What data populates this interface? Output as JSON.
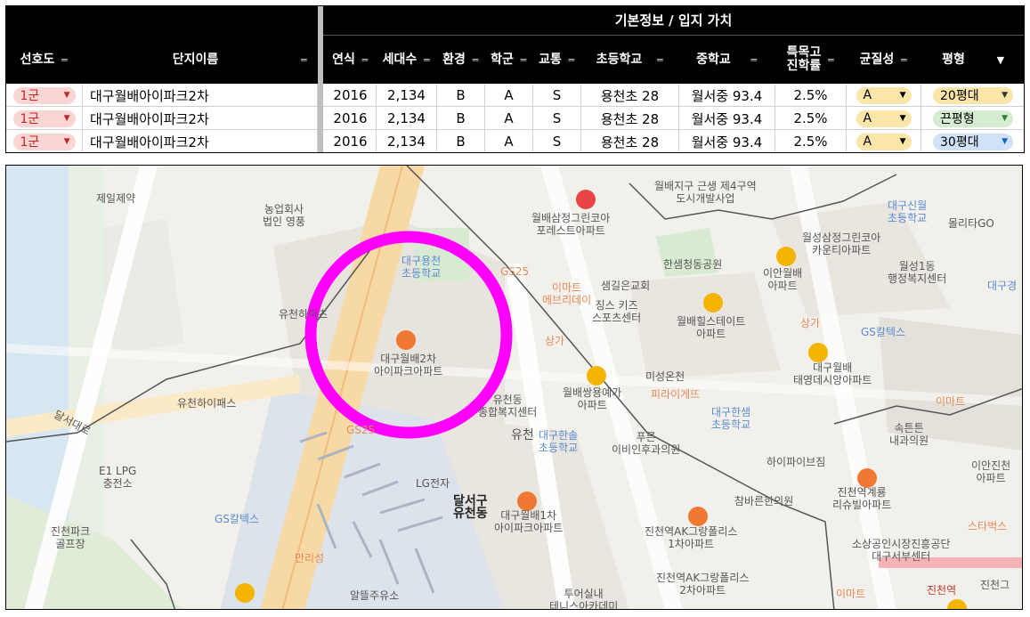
{
  "sheet": {
    "group_title": "기본정보 / 입지 가치",
    "headers": {
      "pref": "선호도",
      "name": "단지이름",
      "year": "연식",
      "households": "세대수",
      "env": "환경",
      "school_district": "학군",
      "transit": "교통",
      "elementary": "초등학교",
      "middle": "중학교",
      "special_hs": "특목고\n진학률",
      "uniformity": "균질성",
      "size": "평형"
    },
    "rows": [
      {
        "pref": "1군",
        "name": "대구월배아이파크2차",
        "year": "2016",
        "households": "2,134",
        "env": "B",
        "school_district": "A",
        "transit": "S",
        "elementary": "용천초 28",
        "middle": "월서중 93.4",
        "special_hs": "2.5%",
        "uniformity": "A",
        "size": "20평대",
        "size_color": "#fbe5a8"
      },
      {
        "pref": "1군",
        "name": "대구월배아이파크2차",
        "year": "2016",
        "households": "2,134",
        "env": "B",
        "school_district": "A",
        "transit": "S",
        "elementary": "용천초 28",
        "middle": "월서중 93.4",
        "special_hs": "2.5%",
        "uniformity": "A",
        "size": "끈평형",
        "size_color": "#d5ecd2"
      },
      {
        "pref": "1군",
        "name": "대구월배아이파크2차",
        "year": "2016",
        "households": "2,134",
        "env": "B",
        "school_district": "A",
        "transit": "S",
        "elementary": "용천초 28",
        "middle": "월서중 93.4",
        "special_hs": "2.5%",
        "uniformity": "A",
        "size": "30평대",
        "size_color": "#cfe2f7"
      }
    ],
    "colors": {
      "pref_chip": "#f9d5d3",
      "pref_text": "#c62828",
      "uniformity_chip": "#fbe5a8"
    }
  },
  "map": {
    "labels": {
      "jeil": "제일제약",
      "nonghyup": "농업회사\n법인 영풍",
      "school_yongcheon": "대구용천\n초등학교",
      "gs25_top": "GS25",
      "emart24": "이마트\n에브리데이",
      "wolbae_green": "월배삼정그린코아\n포레스트아파트",
      "hanshin_park": "한샘청동공원",
      "saemgil_church": "샘길은교회",
      "jiins_kids": "징스 키즈\n스포츠센터",
      "wolbae_hills": "월배힐스테이트\n아파트",
      "sangga1": "상가",
      "main_apt": "대구월배2차\n아이파크아파트",
      "yucheon_hipass": "유천하이패스",
      "dalseo_road": "달서대로",
      "yucheondong_welfare": "유천동\n종합복지센터",
      "wolbae_ssangyong": "월배쌍용예가\n아파트",
      "miseong": "미성온천",
      "school_hansol": "대구한솔\n초등학교",
      "yucheon": "유천",
      "gs_top_right": "GS칼텍스",
      "ian_wolbae": "이안월배\n아파트",
      "wolseong_green": "월성삼정그린코아\n카운티아파트",
      "wolseong1dong": "월성1동\n행정복지센터",
      "daegu_shinwol": "대구신월\n초등학교",
      "molita": "몰리타GO",
      "daegu_gyeong": "대구경",
      "daegu_wolbae_taeyoung": "대구월배\n태영데시앙아파트",
      "daegu_hansaem": "대구한샘\n초등학교",
      "pizza": "피라이게뜨",
      "emart_right": "이마트",
      "soktn": "속튼튼\n내과의원",
      "puren": "푸른\n이비인후과의원",
      "hiplus": "하이파이브짐",
      "ian_jincheon": "이안진천\n아파트",
      "jincheon_ap": "진천역계룡\n리슈빌아파트",
      "e1lpg": "E1 LPG\n충전소",
      "lg": "LG전자",
      "dalseogu": "달서구\n유천동",
      "wolbae1": "대구월배1차\n아이파크아파트",
      "charm": "참바른한의원",
      "jincheon_ak1": "진천역AK그랑폴리스\n1차아파트",
      "gs_bottom": "GS칼텍스",
      "jincheon_park": "진천파크\n골프장",
      "manriseong": "만리성",
      "altteul": "알뜰주유소",
      "starbucks": "스타벅스",
      "sosang": "소상공인시장진흥공단\n대구서부센터",
      "jincheon_ak2": "진천역AK그랑폴리스\n2차아파트",
      "tumeol": "투어실내\n테니스아카데미",
      "jincheon": "진천그",
      "jincheon_station": "진천역",
      "wolbae_district": "월배지구 근생 제4구역\n도시개발사업",
      "sangga2": "상가",
      "yucheon_apt": "유천하이츠",
      "gs25_mid": "GS25",
      "emart_bottom": "이마트"
    },
    "highlight_color": "#ff00ff"
  }
}
